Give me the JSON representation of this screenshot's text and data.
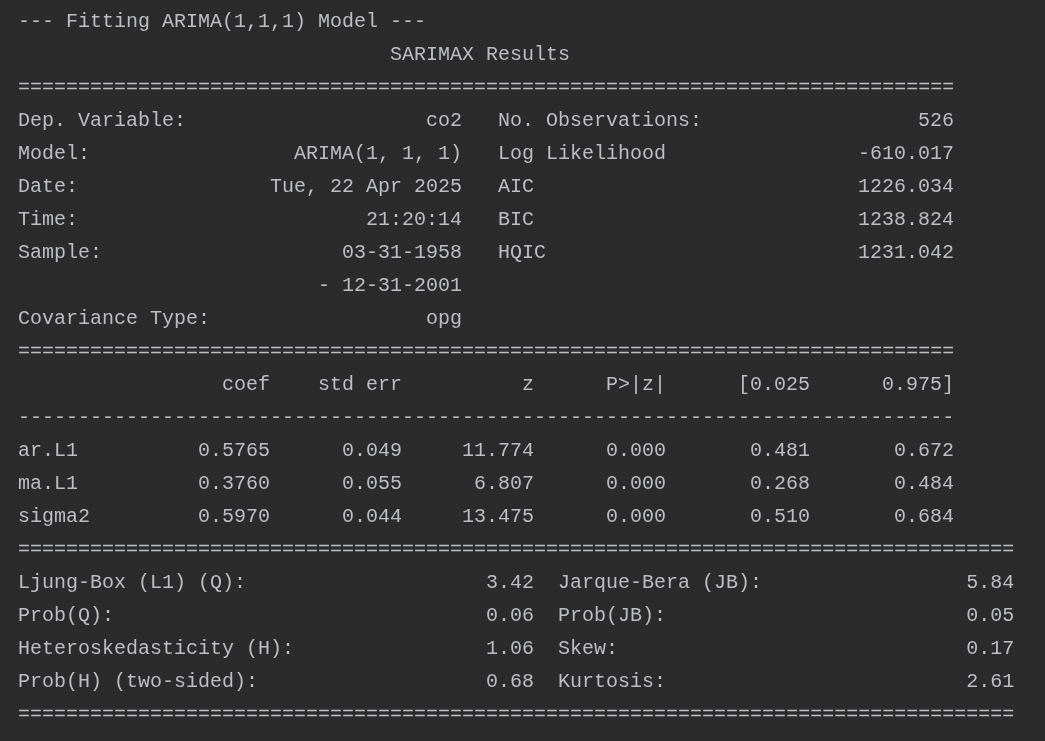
{
  "header": "--- Fitting ARIMA(1,1,1) Model ---",
  "title": "SARIMAX Results",
  "model_info": {
    "rule_top": "==============================================================================",
    "rows": [
      {
        "label": "Dep. Variable:",
        "value": "co2",
        "label_2": "No. Observations:",
        "value_2": "526"
      },
      {
        "label": "Model:",
        "value": "ARIMA(1, 1, 1)",
        "label_2": "Log Likelihood",
        "value_2": "-610.017"
      },
      {
        "label": "Date:",
        "value": "Tue, 22 Apr 2025",
        "label_2": "AIC",
        "value_2": "1226.034"
      },
      {
        "label": "Time:",
        "value": "21:20:14",
        "label_2": "BIC",
        "value_2": "1238.824"
      },
      {
        "label": "Sample:",
        "value": "03-31-1958",
        "label_2": "HQIC",
        "value_2": "1231.042"
      },
      {
        "value": "- 12-31-2001"
      },
      {
        "label": "Covariance Type:",
        "value": "opg"
      }
    ],
    "rule_bottom": "=============================================================================="
  },
  "coefficients": {
    "columns": [
      "coef",
      "std err",
      "z",
      "P>|z|",
      "[0.025",
      "0.975]"
    ],
    "rule": "------------------------------------------------------------------------------",
    "rows": [
      {
        "name": "ar.L1",
        "values": [
          "0.5765",
          "0.049",
          "11.774",
          "0.000",
          "0.481",
          "0.672"
        ]
      },
      {
        "name": "ma.L1",
        "values": [
          "0.3760",
          "0.055",
          "6.807",
          "0.000",
          "0.268",
          "0.484"
        ]
      },
      {
        "name": "sigma2",
        "values": [
          "0.5970",
          "0.044",
          "13.475",
          "0.000",
          "0.510",
          "0.684"
        ]
      }
    ],
    "rule_bottom": "==================================================================================="
  },
  "diagnostics": {
    "rows": [
      {
        "label": "Ljung-Box (L1) (Q):",
        "value": "3.42",
        "label_2": "Jarque-Bera (JB):",
        "value_2": "5.84"
      },
      {
        "label": "Prob(Q):",
        "value": "0.06",
        "label_2": "Prob(JB):",
        "value_2": "0.05"
      },
      {
        "label": "Heteroskedasticity (H):",
        "value": "1.06",
        "label_2": "Skew:",
        "value_2": "0.17"
      },
      {
        "label": "Prob(H) (two-sided):",
        "value": "0.68",
        "label_2": "Kurtosis:",
        "value_2": "2.61"
      }
    ],
    "rule_bottom": "==================================================================================="
  }
}
